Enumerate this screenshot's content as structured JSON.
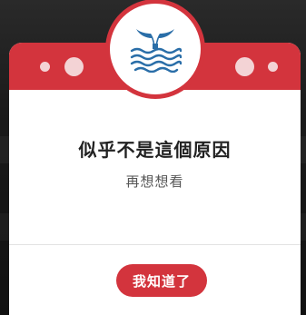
{
  "dialog": {
    "title": "似乎不是這個原因",
    "subtitle": "再想想看",
    "confirm_label": "我知道了",
    "icon": "whale-tail-icon"
  },
  "colors": {
    "accent": "#d3343d",
    "icon": "#2a6ea8",
    "header_dots": "#f3d3d5"
  }
}
